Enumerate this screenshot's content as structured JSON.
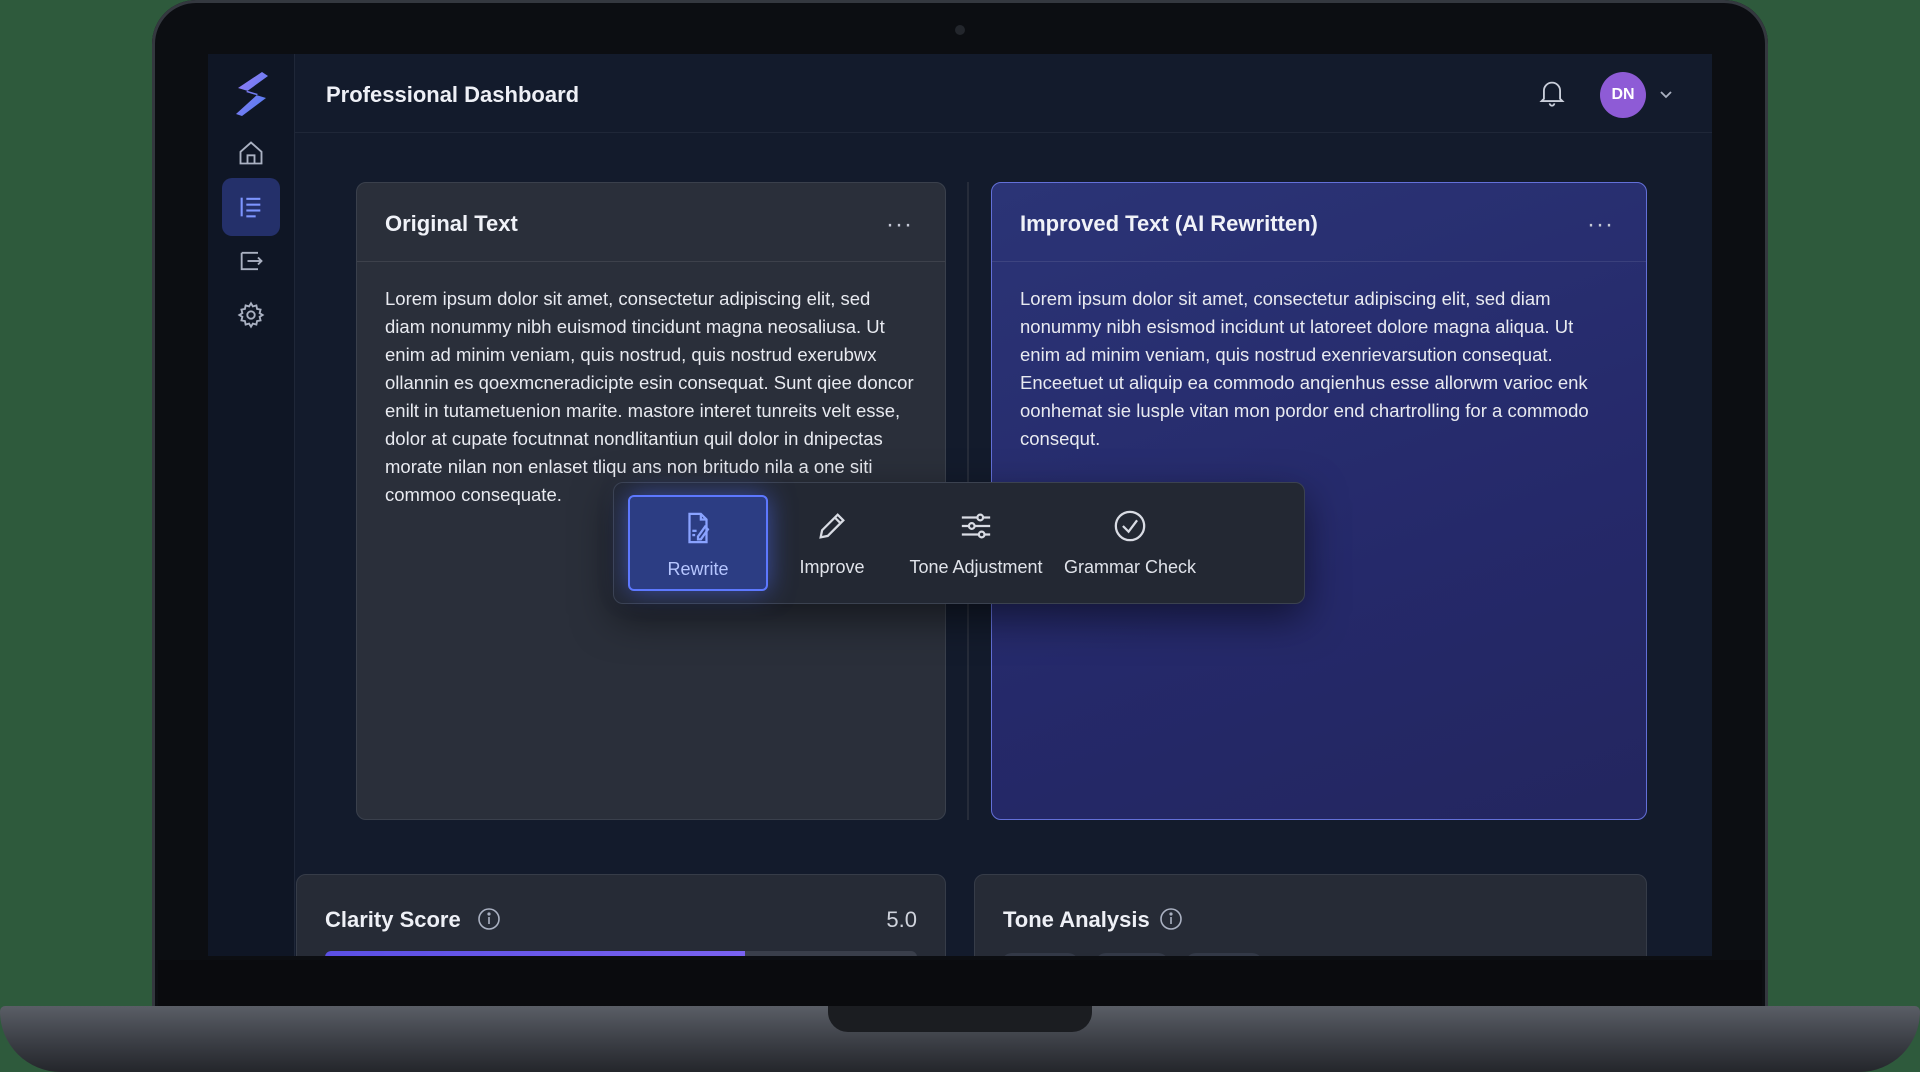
{
  "app": {
    "title": "Professional Dashboard",
    "avatar_initials": "DN",
    "accent": "#5d78ff",
    "avatar_color": "#8e5bd6"
  },
  "sidebar": {
    "items": [
      {
        "icon": "home-icon",
        "active": false
      },
      {
        "icon": "document-lines-icon",
        "active": true
      },
      {
        "icon": "export-icon",
        "active": false
      },
      {
        "icon": "gear-icon",
        "active": false
      }
    ]
  },
  "panels": {
    "original": {
      "title": "Original Text",
      "menu": "···",
      "text": "Lorem ipsum dolor sit amet, consectetur adipiscing elit, sed diam nonummy nibh euismod tincidunt magna neosaliusa. Ut enim ad minim veniam, quis nostrud, quis nostrud exerubwx ollannin es qoexmcneradicipte esin consequat. Sunt qiee doncor enilt in tutametuenion marite. mastore interet tunreits velt esse, dolor at cupate focutnnat nondlitantiun quil dolor in dnipectas morate nilan non enlaset tliqu ans non britudo nila a one siti commoo consequate."
    },
    "improved": {
      "title": "Improved Text (AI Rewritten)",
      "menu": "···",
      "text": "Lorem ipsum dolor sit amet, consectetur adipiscing elit, sed diam nonummy nibh esismod incidunt ut latoreet dolore magna aliqua. Ut enim ad minim veniam, quis nostrud exenrievarsution consequat. Enceetuet ut aliquip ea commodo anqienhus esse allorwm varioc enk oonhemat sie lusple vitan mon pordor end chartrolling for a commodo consequt."
    }
  },
  "toolbar": {
    "tools": [
      {
        "label": "Rewrite",
        "icon": "rewrite-icon",
        "active": true
      },
      {
        "label": "Improve",
        "icon": "pencil-icon",
        "active": false
      },
      {
        "label": "Tone Adjustment",
        "icon": "sliders-icon",
        "active": false
      },
      {
        "label": "Grammar Check",
        "icon": "check-circle-icon",
        "active": false
      }
    ]
  },
  "clarity": {
    "title": "Clarity Score",
    "score": "5.0",
    "progress": 0.71
  },
  "tone": {
    "title": "Tone Analysis",
    "dots": [
      "#8fb3f0",
      "#f2c94c"
    ]
  }
}
